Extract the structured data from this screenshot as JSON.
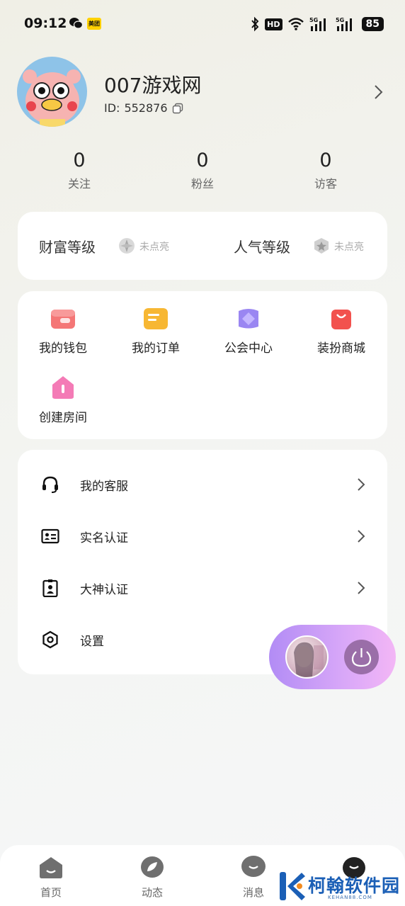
{
  "status_bar": {
    "time": "09:12",
    "meituan_label": "美团",
    "hd_label": "HD",
    "battery": "85"
  },
  "profile": {
    "username": "007游戏网",
    "id_label": "ID:",
    "id_value": "552876"
  },
  "stats": [
    {
      "value": "0",
      "label": "关注"
    },
    {
      "value": "0",
      "label": "粉丝"
    },
    {
      "value": "0",
      "label": "访客"
    }
  ],
  "levels": {
    "wealth": {
      "title": "财富等级",
      "state": "未点亮"
    },
    "popularity": {
      "title": "人气等级",
      "state": "未点亮"
    }
  },
  "grid": [
    {
      "label": "我的钱包",
      "icon": "wallet-icon",
      "color": "#f26a6a"
    },
    {
      "label": "我的订单",
      "icon": "order-icon",
      "color": "#f6b32e"
    },
    {
      "label": "公会中心",
      "icon": "guild-icon",
      "color": "#8e7cf0"
    },
    {
      "label": "装扮商城",
      "icon": "shop-bag-icon",
      "color": "#f0534f"
    },
    {
      "label": "创建房间",
      "icon": "create-room-icon",
      "color": "#f27ab4"
    }
  ],
  "menu": [
    {
      "label": "我的客服",
      "icon": "headset-icon"
    },
    {
      "label": "实名认证",
      "icon": "id-card-icon"
    },
    {
      "label": "大神认证",
      "icon": "badge-icon"
    },
    {
      "label": "设置",
      "icon": "gear-icon"
    }
  ],
  "bottom_nav": [
    {
      "label": "首页",
      "icon": "home-icon"
    },
    {
      "label": "动态",
      "icon": "feed-icon"
    },
    {
      "label": "消息",
      "icon": "message-icon"
    }
  ],
  "watermark": {
    "name": "柯翰软件园",
    "url": "KEHAN88.COM"
  }
}
